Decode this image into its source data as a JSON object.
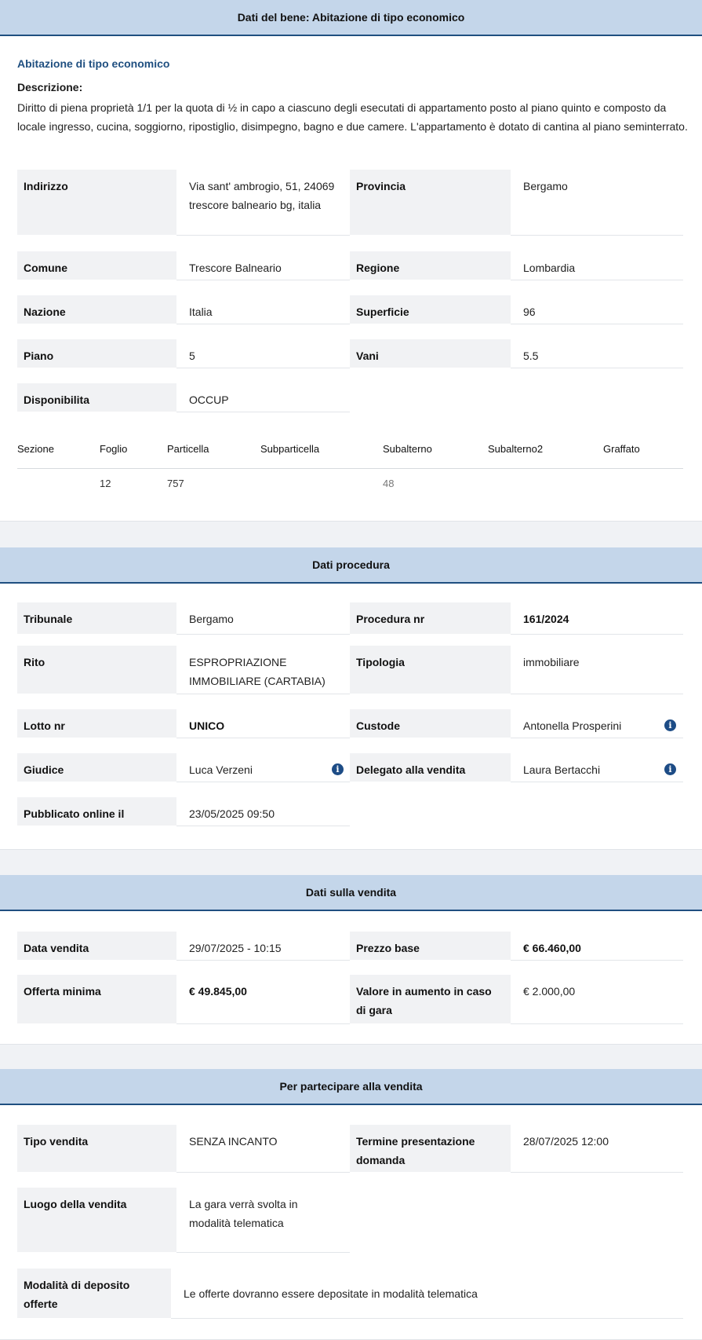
{
  "bene": {
    "header": "Dati del bene: Abitazione di tipo economico",
    "subtitle": "Abitazione di tipo economico",
    "desc_label": "Descrizione:",
    "desc_text": "Diritto di piena proprietà 1/1 per la quota di ½ in capo a ciascuno degli esecutati di appartamento posto al piano quinto e composto da locale ingresso, cucina, soggiorno, ripostiglio, disimpegno, bagno e due camere. L'appartamento è dotato di cantina al piano seminterrato.",
    "fields": {
      "indirizzo_label": "Indirizzo",
      "indirizzo_value": "Via sant' ambrogio, 51, 24069 trescore balneario bg, italia",
      "provincia_label": "Provincia",
      "provincia_value": "Bergamo",
      "comune_label": "Comune",
      "comune_value": "Trescore Balneario",
      "regione_label": "Regione",
      "regione_value": "Lombardia",
      "nazione_label": "Nazione",
      "nazione_value": "Italia",
      "superficie_label": "Superficie",
      "superficie_value": "96",
      "piano_label": "Piano",
      "piano_value": "5",
      "vani_label": "Vani",
      "vani_value": "5.5",
      "disponibilita_label": "Disponibilita",
      "disponibilita_value": "OCCUP"
    },
    "catasto": {
      "headers": [
        "Sezione",
        "Foglio",
        "Particella",
        "Subparticella",
        "Subalterno",
        "Subalterno2",
        "Graffato"
      ],
      "row": [
        "",
        "12",
        "757",
        "",
        "48",
        "",
        ""
      ]
    }
  },
  "procedura": {
    "header": "Dati procedura",
    "tribunale_label": "Tribunale",
    "tribunale_value": "Bergamo",
    "procedura_label": "Procedura nr",
    "procedura_value": "161/2024",
    "rito_label": "Rito",
    "rito_value": "ESPROPRIAZIONE IMMOBILIARE (CARTABIA)",
    "tipologia_label": "Tipologia",
    "tipologia_value": "immobiliare",
    "lotto_label": "Lotto nr",
    "lotto_value": "UNICO",
    "custode_label": "Custode",
    "custode_value": "Antonella Prosperini",
    "giudice_label": "Giudice",
    "giudice_value": "Luca Verzeni",
    "delegato_label": "Delegato alla vendita",
    "delegato_value": "Laura Bertacchi",
    "pubblicato_label": "Pubblicato online il",
    "pubblicato_value": "23/05/2025 09:50"
  },
  "vendita": {
    "header": "Dati sulla vendita",
    "data_label": "Data vendita",
    "data_value": "29/07/2025 - 10:15",
    "prezzo_label": "Prezzo base",
    "prezzo_value": "€ 66.460,00",
    "offerta_label": "Offerta minima",
    "offerta_value": "€ 49.845,00",
    "aumento_label": "Valore in aumento in caso di gara",
    "aumento_value": "€ 2.000,00"
  },
  "partecipare": {
    "header": "Per partecipare alla vendita",
    "tipo_label": "Tipo vendita",
    "tipo_value": "SENZA INCANTO",
    "termine_label": "Termine presentazione domanda",
    "termine_value": "28/07/2025 12:00",
    "luogo_label": "Luogo della vendita",
    "luogo_value": "La gara verrà svolta in modalità telematica",
    "modalita_label": "Modalità di deposito offerte",
    "modalita_value": "Le offerte dovranno essere depositate in modalità telematica"
  },
  "icons": {
    "info": "info-icon"
  },
  "colors": {
    "header_bg": "#c4d6ea",
    "header_border": "#1f4f80",
    "label_bg": "#f1f2f4",
    "info_icon": "#1d4c86"
  }
}
